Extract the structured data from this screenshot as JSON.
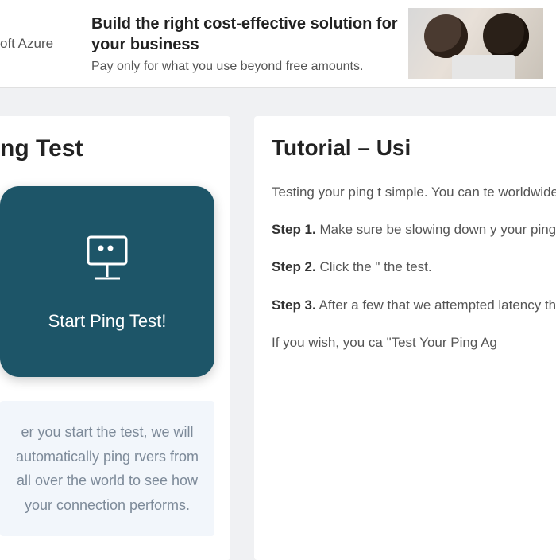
{
  "ad": {
    "brand": "oft Azure",
    "headline": "Build the right cost-effective solution for your business",
    "sub": "Pay only for what you use beyond free amounts."
  },
  "left": {
    "title": "ng Test",
    "button_label": "Start Ping Test!",
    "info": "er you start the test, we will automatically ping rvers from all over the world to see how your connection performs."
  },
  "right": {
    "title": "Tutorial – Usi",
    "intro": "Testing your ping t simple. You can te worldwide with a s",
    "step1_label": "Step 1.",
    "step1_text": " Make sure be slowing down y your ping.",
    "step2_label": "Step 2.",
    "step2_text": " Click the \" the test.",
    "step3_label": "Step 3.",
    "step3_text": " After a few that we attempted latency they had.",
    "closing": "If you wish, you ca \"Test Your Ping Ag"
  }
}
